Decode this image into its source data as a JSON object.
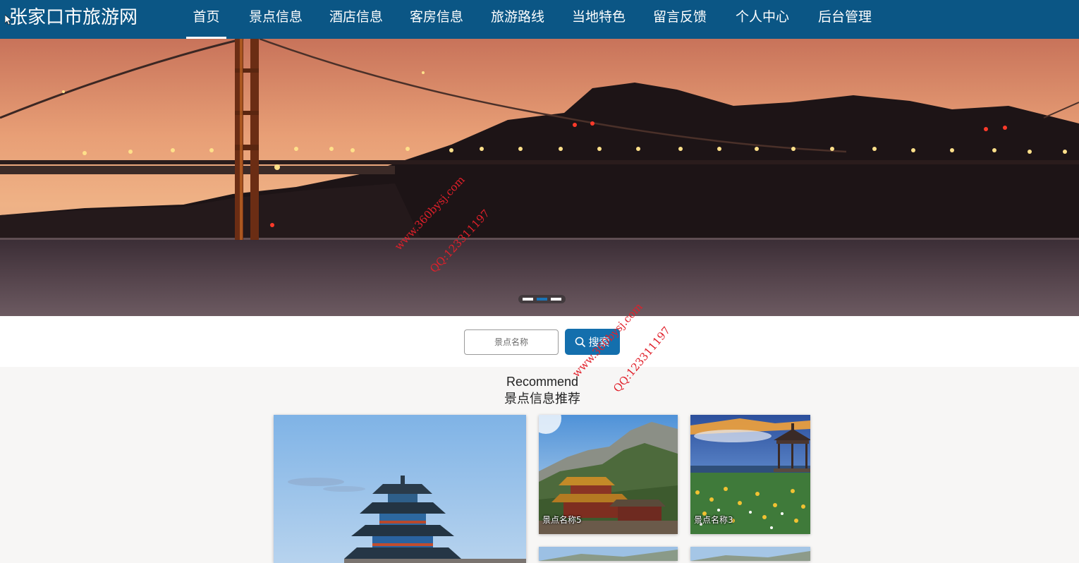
{
  "header": {
    "site_title": "张家口市旅游网",
    "nav": [
      {
        "label": "首页",
        "active": true
      },
      {
        "label": "景点信息"
      },
      {
        "label": "酒店信息"
      },
      {
        "label": "客房信息"
      },
      {
        "label": "旅游路线"
      },
      {
        "label": "当地特色"
      },
      {
        "label": "留言反馈"
      },
      {
        "label": "个人中心"
      },
      {
        "label": "后台管理"
      }
    ]
  },
  "carousel": {
    "slide_count": 3,
    "active_slide": 2,
    "image": "golden-gate-bridge-sunset"
  },
  "search": {
    "placeholder": "景点名称",
    "button_label": "搜索",
    "button_icon": "search-icon"
  },
  "recommend": {
    "title_en": "Recommend",
    "title_cn": "景点信息推荐",
    "cards": [
      {
        "label": "",
        "image": "pagoda-tower"
      },
      {
        "label": "景点名称5",
        "image": "mountain-temple"
      },
      {
        "label": "景点名称3",
        "image": "grassland-pavilion"
      }
    ]
  },
  "watermarks": [
    {
      "site": "www.360bysj.com",
      "qq": "QQ:123311197"
    },
    {
      "site": "www.360bysj.com",
      "qq": "QQ:123311197"
    }
  ],
  "colors": {
    "header_bg": "#0b5685",
    "button_bg": "#146fad",
    "watermark": "#e0202a"
  }
}
